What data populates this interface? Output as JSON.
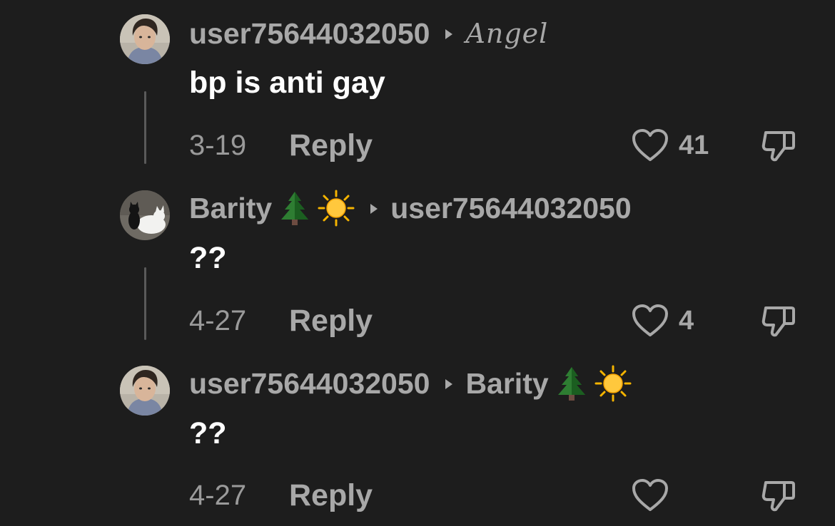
{
  "comments": [
    {
      "author": "user75644032050",
      "reply_to": "Angel",
      "text": "bp is anti gay",
      "date": "3-19",
      "reply_label": "Reply",
      "likes": "41",
      "avatar_icon": "person-photo-avatar",
      "reply_to_style": "script"
    },
    {
      "author": "Barity",
      "author_emojis": [
        "evergreen-tree-icon",
        "sun-icon"
      ],
      "reply_to": "user75644032050",
      "text": "??",
      "date": "4-27",
      "reply_label": "Reply",
      "likes": "4",
      "avatar_icon": "cats-photo-avatar"
    },
    {
      "author": "user75644032050",
      "reply_to": "Barity",
      "reply_to_emojis": [
        "evergreen-tree-icon",
        "sun-icon"
      ],
      "text": "??",
      "date": "4-27",
      "reply_label": "Reply",
      "likes": "",
      "avatar_icon": "person-photo-avatar"
    }
  ],
  "colors": {
    "background": "#1d1d1d",
    "text_primary": "#ffffff",
    "text_secondary": "#a8a8a8",
    "thread_line": "#5a5a5a"
  }
}
